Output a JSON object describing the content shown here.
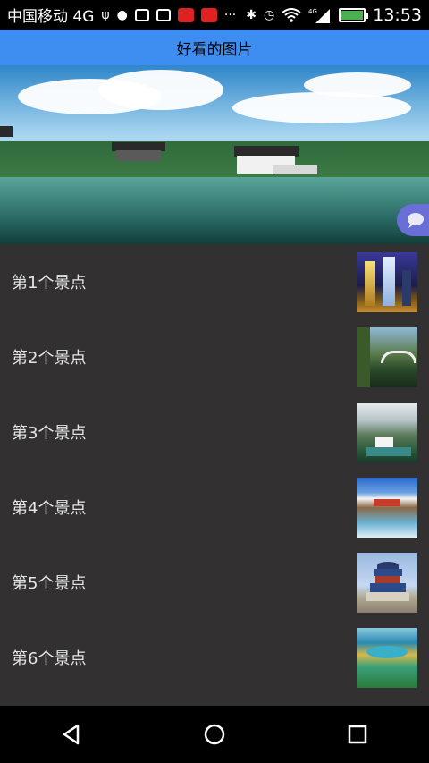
{
  "status_bar": {
    "carrier": "中国移动 4G",
    "network": "4G",
    "time": "13:53",
    "icons": [
      "usb-icon",
      "android-icon",
      "mail-icon",
      "emoji-icon",
      "app-badge-icon",
      "app-badge-icon",
      "more-icon",
      "bluetooth-icon",
      "alarm-icon",
      "wifi-icon",
      "signal-icon",
      "battery-icon"
    ],
    "overflow_glyph": "···"
  },
  "header": {
    "title": "好看的图片"
  },
  "banner": {
    "image": "lake-landscape",
    "floating_button_icon": "chat-bubble-icon"
  },
  "list": {
    "items": [
      {
        "label": "第1个景点",
        "thumbnail": "pagodas-night"
      },
      {
        "label": "第2个景点",
        "thumbnail": "stone-bridge"
      },
      {
        "label": "第3个景点",
        "thumbnail": "karst-mountains"
      },
      {
        "label": "第4个景点",
        "thumbnail": "snow-mountain-river"
      },
      {
        "label": "第5个景点",
        "thumbnail": "temple-of-heaven"
      },
      {
        "label": "第6个景点",
        "thumbnail": "colorful-lake"
      }
    ]
  },
  "nav_bar": {
    "back": "back-icon",
    "home": "home-icon",
    "recents": "recents-icon"
  },
  "colors": {
    "title_bar": "#3d8ef0",
    "list_background": "#333031",
    "item_text": "#e6e6e6"
  }
}
